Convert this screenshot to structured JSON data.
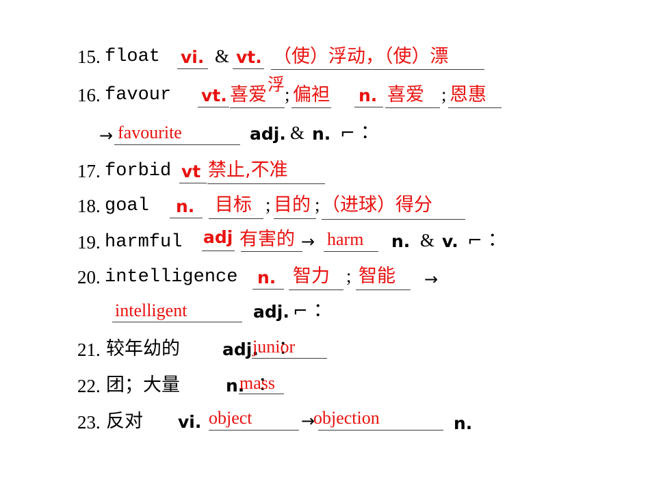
{
  "document": {
    "type": "vocabulary-worksheet-slide",
    "background_color": "#ffffff",
    "answer_color": "#E8110E",
    "text_color": "#000000",
    "rule_color": "#3b3b3b"
  },
  "entries": [
    {
      "number": "15.",
      "headword": "float",
      "answers": [
        "vi.",
        "vt.",
        "（使）浮动，（使）漂"
      ],
      "black_parts": [
        ".",
        "&",
        "."
      ]
    },
    {
      "number": "16.",
      "headword": "favour",
      "answers": [
        "vt.",
        "喜爱",
        "偏袒",
        "n.",
        "喜爱",
        "恩惠"
      ],
      "floating_char": "浮",
      "derivation": {
        "arrow": "→",
        "word": "favourite",
        "pos": "adj.",
        "conj": "&",
        "pos2": "n.",
        "corner": "⌐",
        "colon": "："
      }
    },
    {
      "number": "17.",
      "headword": "forbid",
      "answers": [
        "vt",
        "禁止,不准"
      ]
    },
    {
      "number": "18.",
      "headword": "goal",
      "answers": [
        "n.",
        "目标",
        "目的",
        "（进球）得分"
      ],
      "separators": [
        ";",
        ";"
      ]
    },
    {
      "number": "19.",
      "headword": "harmful",
      "answers": [
        "adj",
        "有害的"
      ],
      "derivation": {
        "arrow": "→",
        "word": "harm",
        "pos": "n.",
        "conj": "&",
        "pos2": "v.",
        "corner": "⌐",
        "colon": "："
      }
    },
    {
      "number": "20.",
      "headword": "intelligence",
      "answers": [
        "n.",
        "智力",
        "智能"
      ],
      "separators": [
        ";"
      ],
      "derivation": {
        "arrow": "→",
        "word": "intelligent",
        "pos": "adj.",
        "corner": "⌐",
        "colon": "："
      }
    },
    {
      "number": "21.",
      "prompt": "较年幼的",
      "pos": "adj.",
      "colon": "：",
      "answer": "junior"
    },
    {
      "number": "22.",
      "prompt": "团；大量",
      "pos": "n.",
      "colon": "：",
      "answer": "mass"
    },
    {
      "number": "23.",
      "prompt": "反对",
      "pos": "vi.",
      "answer": "object",
      "arrow": "→",
      "answer2": "objection",
      "pos2": "n."
    }
  ]
}
